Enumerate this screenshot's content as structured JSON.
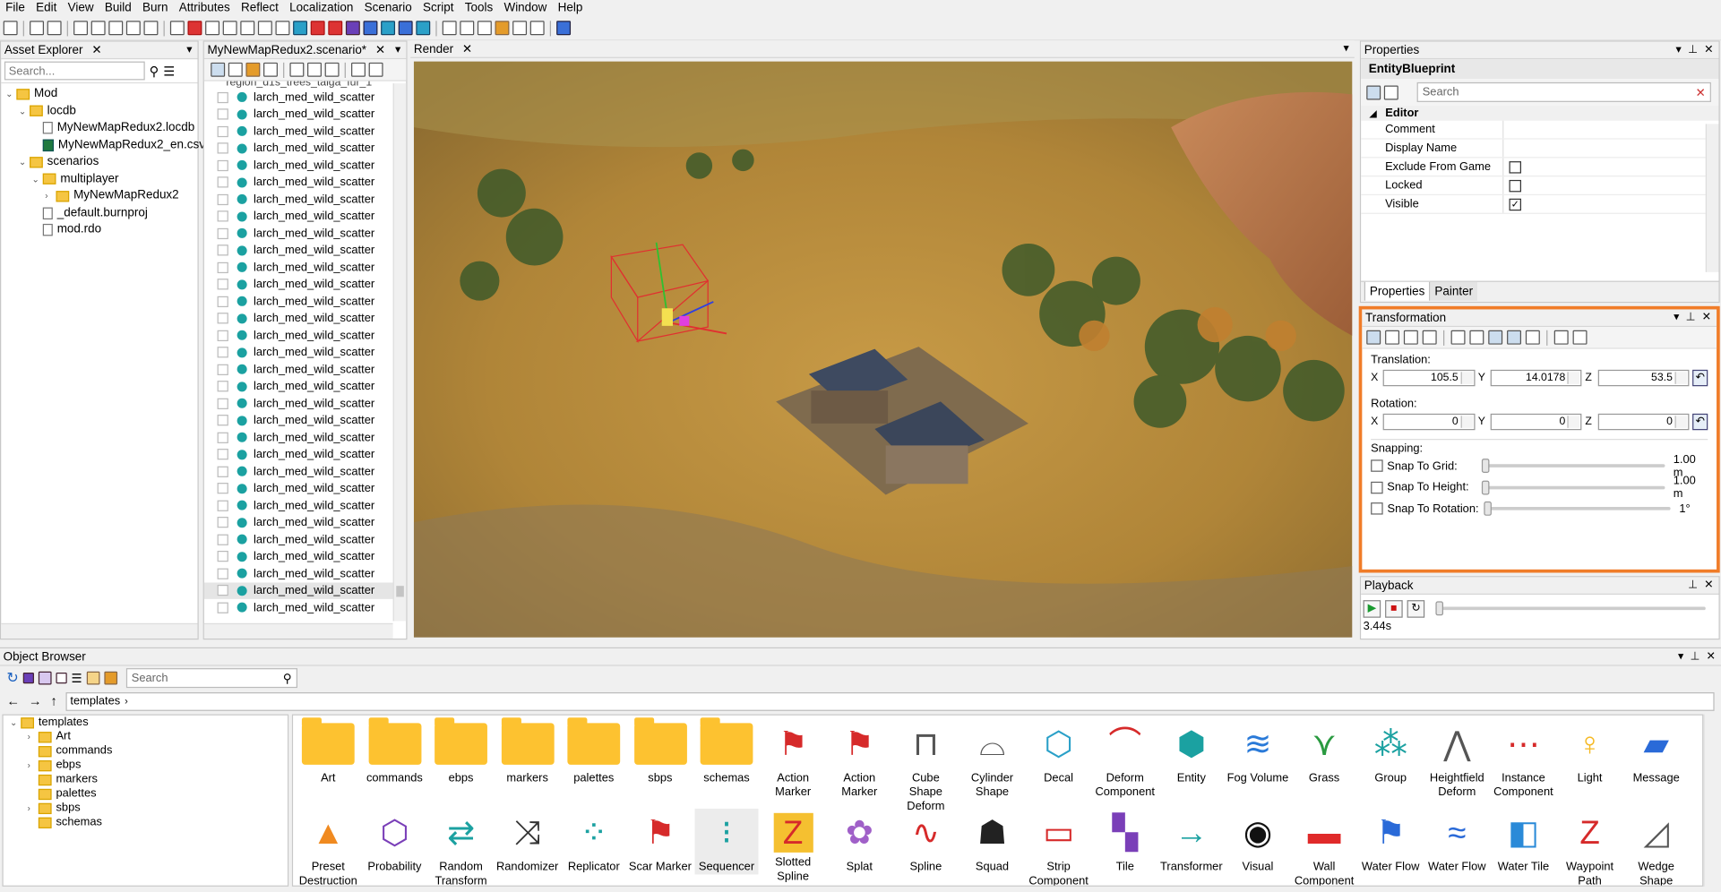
{
  "menu": [
    "File",
    "Edit",
    "View",
    "Build",
    "Burn",
    "Attributes",
    "Reflect",
    "Localization",
    "Scenario",
    "Script",
    "Tools",
    "Window",
    "Help"
  ],
  "asset_explorer": {
    "title": "Asset Explorer",
    "search_placeholder": "Search...",
    "tree": [
      {
        "label": "Mod",
        "level": 0,
        "type": "folder",
        "expanded": true
      },
      {
        "label": "locdb",
        "level": 1,
        "type": "folder",
        "expanded": true
      },
      {
        "label": "MyNewMapRedux2.locdb",
        "level": 2,
        "type": "file"
      },
      {
        "label": "MyNewMapRedux2_en.csv",
        "level": 2,
        "type": "xls"
      },
      {
        "label": "scenarios",
        "level": 1,
        "type": "folder",
        "expanded": true
      },
      {
        "label": "multiplayer",
        "level": 2,
        "type": "folder",
        "expanded": true
      },
      {
        "label": "MyNewMapRedux2",
        "level": 3,
        "type": "folder",
        "expanded": false
      },
      {
        "label": "_default.burnproj",
        "level": 2,
        "type": "file"
      },
      {
        "label": "mod.rdo",
        "level": 2,
        "type": "file"
      }
    ]
  },
  "scenario_panel": {
    "title": "MyNewMapRedux2.scenario*",
    "header_partial": "region_d1s_trees_taiga_fur_1",
    "item_label": "larch_med_wild_scatter",
    "item_count": 31,
    "selected_index": 29
  },
  "render": {
    "title": "Render"
  },
  "properties": {
    "title": "Properties",
    "entity": "EntityBlueprint",
    "search_placeholder": "Search",
    "category": "Editor",
    "rows": [
      {
        "key": "Comment",
        "value": ""
      },
      {
        "key": "Display Name",
        "value": ""
      },
      {
        "key": "Exclude From Game",
        "checkbox": false
      },
      {
        "key": "Locked",
        "checkbox": false
      },
      {
        "key": "Visible",
        "checkbox": true
      }
    ],
    "tabs": [
      "Properties",
      "Painter"
    ]
  },
  "transformation": {
    "title": "Transformation",
    "translation_label": "Translation:",
    "translation": {
      "x": "105.5",
      "y": "14.0178",
      "z": "53.5"
    },
    "rotation_label": "Rotation:",
    "rotation": {
      "x": "0",
      "y": "0",
      "z": "0"
    },
    "axes": [
      "X",
      "Y",
      "Z"
    ],
    "snapping_label": "Snapping:",
    "snaps": [
      {
        "label": "Snap To Grid:",
        "value": "1.00 m"
      },
      {
        "label": "Snap To Height:",
        "value": "1.00 m"
      },
      {
        "label": "Snap To Rotation:",
        "value": "1°"
      }
    ],
    "highlight_color": "#f07c28"
  },
  "playback": {
    "title": "Playback",
    "time": "3.44s"
  },
  "object_browser": {
    "title": "Object Browser",
    "search_placeholder": "Search",
    "breadcrumb": "templates",
    "tree": [
      {
        "label": "templates",
        "level": 0,
        "expanded": true
      },
      {
        "label": "Art",
        "level": 1,
        "collapsed": true
      },
      {
        "label": "commands",
        "level": 1
      },
      {
        "label": "ebps",
        "level": 1,
        "collapsed": true
      },
      {
        "label": "markers",
        "level": 1
      },
      {
        "label": "palettes",
        "level": 1
      },
      {
        "label": "sbps",
        "level": 1,
        "collapsed": true
      },
      {
        "label": "schemas",
        "level": 1
      }
    ],
    "row1": [
      {
        "label": "Art",
        "icon": "folder-icon"
      },
      {
        "label": "commands",
        "icon": "folder-icon"
      },
      {
        "label": "ebps",
        "icon": "folder-icon"
      },
      {
        "label": "markers",
        "icon": "folder-icon"
      },
      {
        "label": "palettes",
        "icon": "folder-icon"
      },
      {
        "label": "sbps",
        "icon": "folder-icon"
      },
      {
        "label": "schemas",
        "icon": "folder-icon"
      },
      {
        "label": "Action Marker",
        "icon": "flag-icon"
      },
      {
        "label": "Action Marker",
        "icon": "flag-icon"
      },
      {
        "label": "Cube Shape Deform",
        "icon": "cube-shape-icon"
      },
      {
        "label": "Cylinder Shape",
        "icon": "cylinder-icon"
      },
      {
        "label": "Decal",
        "icon": "decal-icon"
      },
      {
        "label": "Deform Component",
        "icon": "deform-icon"
      },
      {
        "label": "Entity",
        "icon": "cube-icon"
      },
      {
        "label": "Fog Volume",
        "icon": "fog-icon"
      },
      {
        "label": "Grass",
        "icon": "grass-icon"
      },
      {
        "label": "Group",
        "icon": "group-icon"
      },
      {
        "label": "Heightfield Deform",
        "icon": "heightfield-icon"
      },
      {
        "label": "Instance Component",
        "icon": "instance-icon"
      },
      {
        "label": "Light",
        "icon": "light-icon"
      },
      {
        "label": "Message",
        "icon": "message-icon"
      }
    ],
    "row2": [
      {
        "label": "Preset Destruction",
        "icon": "warning-icon"
      },
      {
        "label": "Probability",
        "icon": "dice-icon"
      },
      {
        "label": "Random Transform",
        "icon": "random-icon"
      },
      {
        "label": "Randomizer",
        "icon": "shuffle-icon"
      },
      {
        "label": "Replicator",
        "icon": "replicator-icon"
      },
      {
        "label": "Scar Marker",
        "icon": "scar-flag-icon"
      },
      {
        "label": "Sequencer",
        "icon": "sequencer-icon"
      },
      {
        "label": "Slotted Spline",
        "icon": "slotted-spline-icon"
      },
      {
        "label": "Splat",
        "icon": "splat-icon"
      },
      {
        "label": "Spline",
        "icon": "spline-icon"
      },
      {
        "label": "Squad",
        "icon": "squad-icon"
      },
      {
        "label": "Strip Component",
        "icon": "strip-icon"
      },
      {
        "label": "Tile",
        "icon": "tile-icon"
      },
      {
        "label": "Transformer",
        "icon": "transformer-icon"
      },
      {
        "label": "Visual",
        "icon": "eye-icon"
      },
      {
        "label": "Wall Component",
        "icon": "wall-icon"
      },
      {
        "label": "Water Flow",
        "icon": "water-flag-icon"
      },
      {
        "label": "Water Flow",
        "icon": "water-flow-icon"
      },
      {
        "label": "Water Tile",
        "icon": "water-tile-icon"
      },
      {
        "label": "Waypoint Path",
        "icon": "waypoint-icon"
      },
      {
        "label": "Wedge Shape",
        "icon": "wedge-icon"
      }
    ]
  }
}
